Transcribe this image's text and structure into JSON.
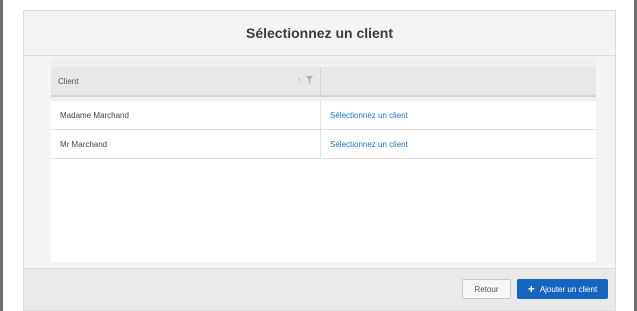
{
  "modal": {
    "title": "Sélectionnez un client"
  },
  "table": {
    "columns": [
      "Client",
      ""
    ],
    "rows": [
      {
        "client": "Madame Marchand",
        "action": "Sélectionnez un client"
      },
      {
        "client": "Mr Marchand",
        "action": "Sélectionnez un client"
      }
    ]
  },
  "footer": {
    "back_label": "Retour",
    "add_label": "Ajouter un client"
  },
  "icons": {
    "sort": "sort-icon",
    "filter": "filter-icon",
    "plus": "plus-icon"
  },
  "colors": {
    "primary": "#1565c0",
    "link": "#1a73c8"
  }
}
